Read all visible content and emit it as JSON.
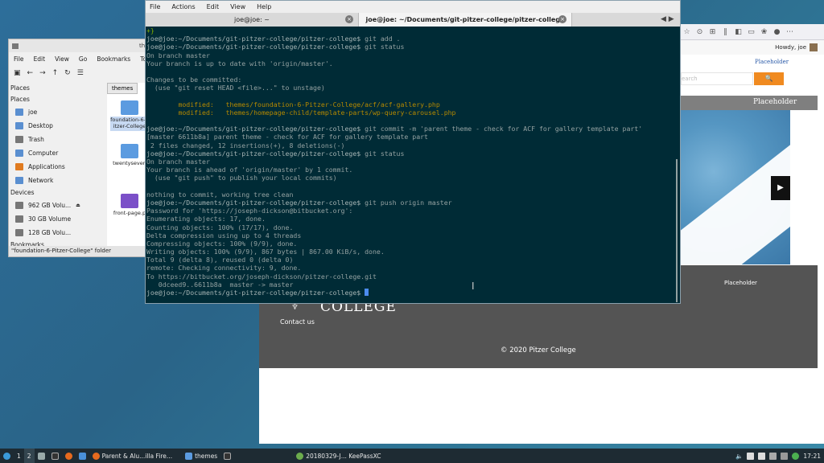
{
  "browser": {
    "toolbar_icons": [
      "☆",
      "⊙",
      "⊞",
      "‖",
      "◧",
      "▭",
      "❀",
      "●",
      "⋯"
    ],
    "admin_greeting": "Howdy, joe",
    "nav_link": "Placeholder",
    "search_placeholder": "earch",
    "search_button": "🔍",
    "band_title": "Placeholder",
    "next_arrow": "▶",
    "footer_placeholder": "Placeholder",
    "college_wordmark": "COLLEGE",
    "contact_link": "Contact us",
    "copyright": "© 2020 Pitzer College"
  },
  "file_manager": {
    "title": "the",
    "menu": [
      "File",
      "Edit",
      "View",
      "Go",
      "Bookmarks",
      "Tool"
    ],
    "toolbar": [
      "▣",
      "←",
      "→",
      "↑",
      "↻",
      "☰"
    ],
    "places_header": "Places",
    "places_subheader": "Places",
    "places": [
      "joe",
      "Desktop",
      "Trash",
      "Computer",
      "Applications",
      "Network"
    ],
    "devices_header": "Devices",
    "devices": [
      "962 GB Volu...",
      "30 GB Volume",
      "128 GB Volu..."
    ],
    "bookmarks_header": "Bookmarks",
    "tab": "themes",
    "files": [
      "foundation-6-Pitzer-College",
      "twentyseven",
      "front-page.p"
    ],
    "status": "\"foundation-6-Pitzer-College\" folder"
  },
  "terminal": {
    "menu": [
      "File",
      "Actions",
      "Edit",
      "View",
      "Help"
    ],
    "tabs": [
      "joe@joe: ~",
      "joe@joe: ~/Documents/git-pitzer-college/pitzer-college"
    ],
    "tab_close": "×",
    "tab_nav": "◀ ▶",
    "prompt": "joe@joe:~/Documents/git-pitzer-college/pitzer-college$",
    "lines": [
      {
        "kind": "plus",
        "text": "+}"
      },
      {
        "kind": "cmd",
        "text": " git add ."
      },
      {
        "kind": "cmd",
        "text": " git status"
      },
      {
        "kind": "out",
        "text": "On branch master"
      },
      {
        "kind": "out",
        "text": "Your branch is up to date with 'origin/master'."
      },
      {
        "kind": "out",
        "text": ""
      },
      {
        "kind": "out",
        "text": "Changes to be committed:"
      },
      {
        "kind": "out",
        "text": "  (use \"git reset HEAD <file>...\" to unstage)"
      },
      {
        "kind": "out",
        "text": ""
      },
      {
        "kind": "mod",
        "text": "\tmodified:   themes/foundation-6-Pitzer-College/acf/acf-gallery.php"
      },
      {
        "kind": "mod",
        "text": "\tmodified:   themes/homepage-child/template-parts/wp-query-carousel.php"
      },
      {
        "kind": "out",
        "text": ""
      },
      {
        "kind": "cmd",
        "text": " git commit -m 'parent theme - check for ACF for gallery template part'"
      },
      {
        "kind": "out",
        "text": "[master 6611b8a] parent theme - check for ACF for gallery template part"
      },
      {
        "kind": "out",
        "text": " 2 files changed, 12 insertions(+), 8 deletions(-)"
      },
      {
        "kind": "cmd",
        "text": " git status"
      },
      {
        "kind": "out",
        "text": "On branch master"
      },
      {
        "kind": "out",
        "text": "Your branch is ahead of 'origin/master' by 1 commit."
      },
      {
        "kind": "out",
        "text": "  (use \"git push\" to publish your local commits)"
      },
      {
        "kind": "out",
        "text": ""
      },
      {
        "kind": "out",
        "text": "nothing to commit, working tree clean"
      },
      {
        "kind": "cmd",
        "text": " git push origin master"
      },
      {
        "kind": "out",
        "text": "Password for 'https://joseph-dickson@bitbucket.org':"
      },
      {
        "kind": "out",
        "text": "Enumerating objects: 17, done."
      },
      {
        "kind": "out",
        "text": "Counting objects: 100% (17/17), done."
      },
      {
        "kind": "out",
        "text": "Delta compression using up to 4 threads"
      },
      {
        "kind": "out",
        "text": "Compressing objects: 100% (9/9), done."
      },
      {
        "kind": "out",
        "text": "Writing objects: 100% (9/9), 867 bytes | 867.00 KiB/s, done."
      },
      {
        "kind": "out",
        "text": "Total 9 (delta 8), reused 0 (delta 0)"
      },
      {
        "kind": "out",
        "text": "remote: Checking connectivity: 9, done."
      },
      {
        "kind": "out",
        "text": "To https://bitbucket.org/joseph-dickson/pitzer-college.git"
      },
      {
        "kind": "out",
        "text": "   0dceed9..6611b8a  master -> master"
      },
      {
        "kind": "cursor",
        "text": " "
      }
    ]
  },
  "taskbar": {
    "workspaces": [
      "1",
      "2"
    ],
    "tasks": [
      "Parent & Alu...illa Fire...",
      "themes",
      "20180329-J... KeePassXC"
    ],
    "clock": "17:21"
  }
}
